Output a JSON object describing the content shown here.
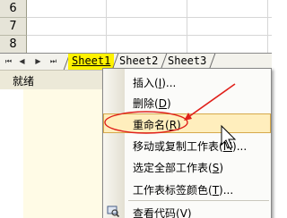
{
  "grid": {
    "rows": [
      "6",
      "7",
      "8"
    ]
  },
  "tabbar": {
    "nav": [
      "⏮",
      "◀",
      "▶",
      "⏭"
    ],
    "tabs": [
      "Sheet1",
      "Sheet2",
      "Sheet3"
    ],
    "active_tab": "Sheet1"
  },
  "status": {
    "text": "就绪"
  },
  "menu": {
    "items": [
      {
        "label": "插入(",
        "key": "I",
        "suffix": ")..."
      },
      {
        "label": "删除(",
        "key": "D",
        "suffix": ")"
      },
      {
        "label": "重命名(",
        "key": "R",
        "suffix": ")"
      },
      {
        "label": "移动或复制工作表(",
        "key": "M",
        "suffix": ")..."
      },
      {
        "label": "选定全部工作表(",
        "key": "S",
        "suffix": ")"
      },
      {
        "label": "工作表标签颜色(",
        "key": "T",
        "suffix": ")..."
      },
      {
        "label": "查看代码(",
        "key": "V",
        "suffix": ")"
      }
    ],
    "highlighted_index": 2
  },
  "colors": {
    "active_tab": "#fff200",
    "highlight_bg": "#ffeebd",
    "annotation": "#e0201a"
  }
}
